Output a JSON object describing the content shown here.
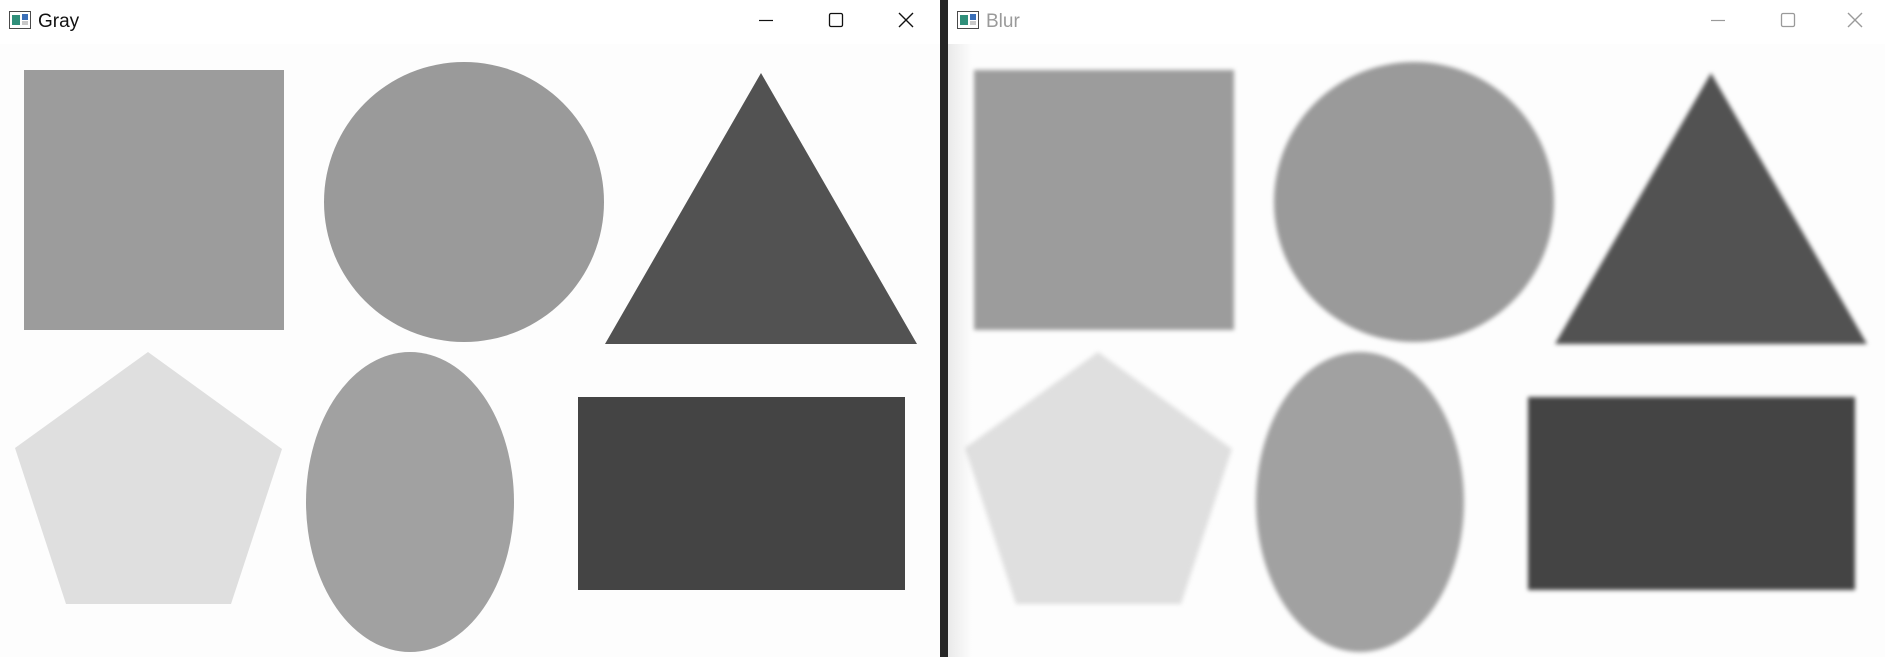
{
  "windows": [
    {
      "title": "Gray",
      "icon": "opencv-window-icon",
      "controls": [
        "minimize-icon",
        "maximize-icon",
        "close-icon"
      ],
      "focused": true,
      "blurred": false
    },
    {
      "title": "Blur",
      "icon": "opencv-window-icon",
      "controls": [
        "minimize-icon",
        "maximize-icon",
        "close-icon"
      ],
      "focused": false,
      "blurred": true
    }
  ],
  "shapes": [
    {
      "name": "square",
      "color": "#9c9c9c"
    },
    {
      "name": "circle",
      "color": "#9a9a9a"
    },
    {
      "name": "triangle",
      "color": "#525252"
    },
    {
      "name": "pentagon",
      "color": "#dfdfdf"
    },
    {
      "name": "ellipse",
      "color": "#a1a1a1"
    },
    {
      "name": "rectangle",
      "color": "#444444"
    }
  ]
}
